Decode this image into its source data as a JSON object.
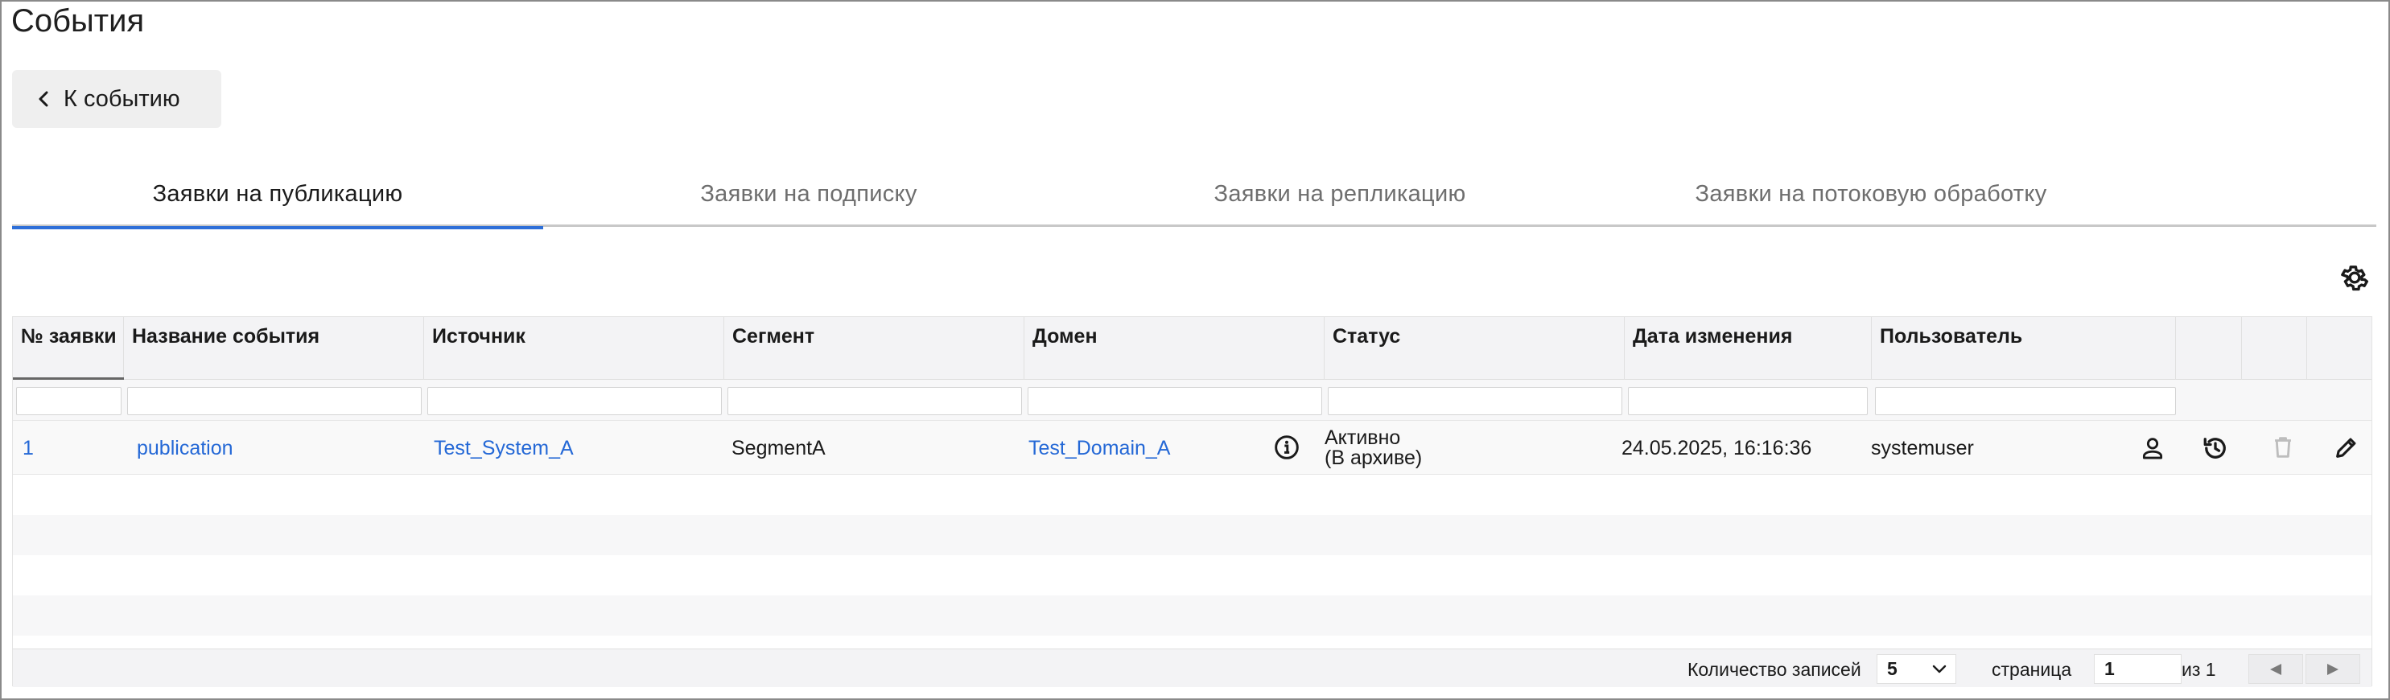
{
  "page": {
    "title": "События"
  },
  "back_button": {
    "label": "К событию",
    "icon": "chevron-left-icon"
  },
  "tabs": [
    {
      "label": "Заявки на публикацию",
      "active": true
    },
    {
      "label": "Заявки на подписку",
      "active": false
    },
    {
      "label": "Заявки на репликацию",
      "active": false
    },
    {
      "label": "Заявки на потоковую обработку",
      "active": false
    }
  ],
  "toolbar": {
    "settings_icon": "gear-icon"
  },
  "table": {
    "columns": [
      {
        "label": "№ заявки"
      },
      {
        "label": "Название события"
      },
      {
        "label": "Источник"
      },
      {
        "label": "Сегмент"
      },
      {
        "label": "Домен"
      },
      {
        "label": "Статус"
      },
      {
        "label": "Дата изменения"
      },
      {
        "label": "Пользователь"
      }
    ],
    "rows": [
      {
        "id": "1",
        "event_name": "publication",
        "source": "Test_System_A",
        "segment": "SegmentA",
        "domain": "Test_Domain_A",
        "status_line1": "Активно",
        "status_line2": "(В архиве)",
        "changed_at": "24.05.2025, 16:16:36",
        "user": "systemuser",
        "actions": [
          "user-icon",
          "history-icon",
          "trash-icon",
          "pencil-icon"
        ]
      }
    ],
    "info_icon": "info-icon"
  },
  "footer": {
    "records_label": "Количество записей",
    "records_value": "5",
    "page_label": "страница",
    "page_value": "1",
    "page_total": "из 1"
  },
  "colors": {
    "accent": "#2e6fd8",
    "link": "#2468d6",
    "header_bg": "#f3f3f5"
  }
}
